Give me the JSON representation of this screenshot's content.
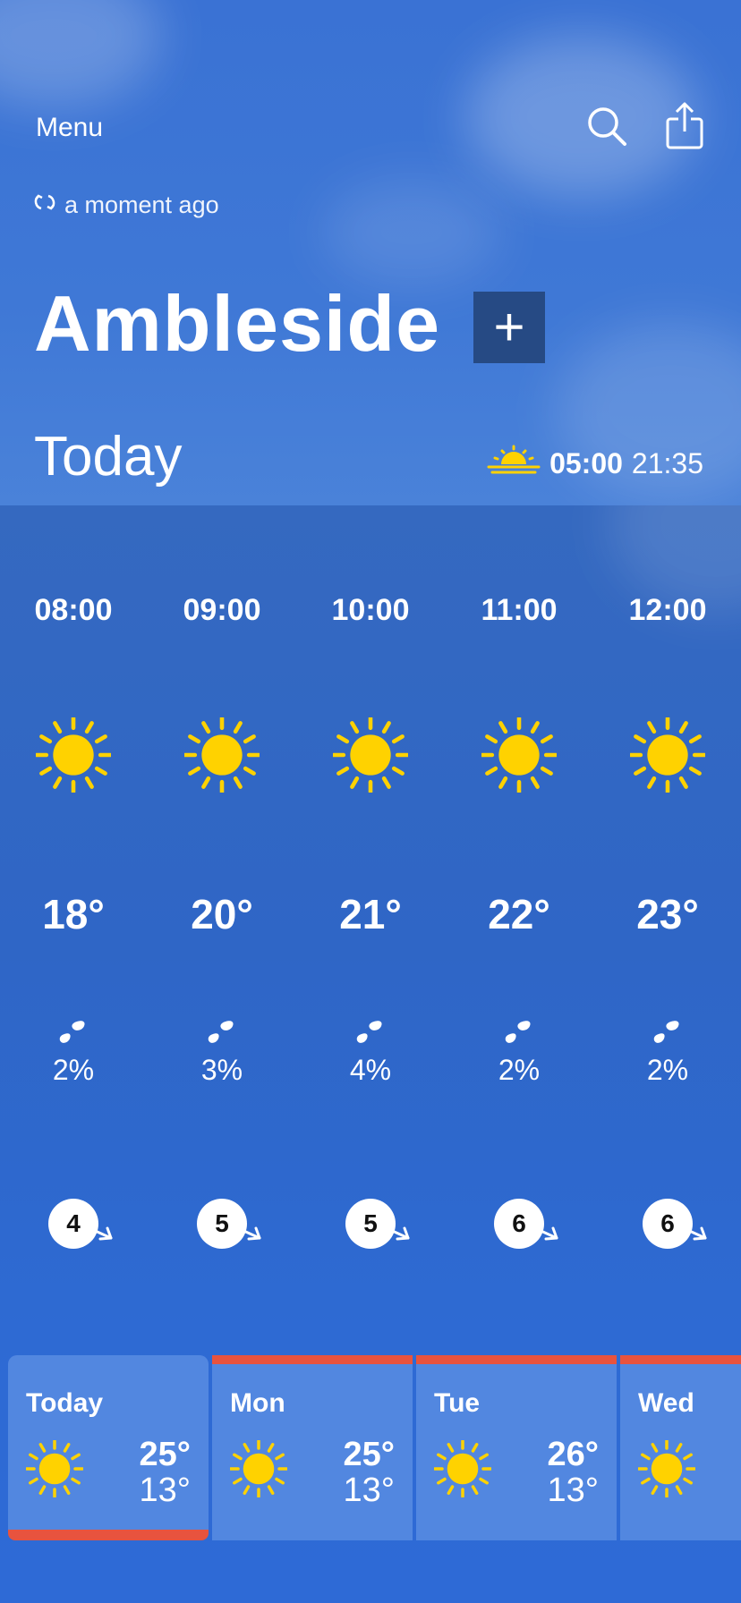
{
  "header": {
    "menu_label": "Menu",
    "updated_text": "a moment ago"
  },
  "location": {
    "name": "Ambleside",
    "add_label": "+"
  },
  "today": {
    "heading": "Today",
    "sunrise": "05:00",
    "sunset": "21:35"
  },
  "hourly": [
    {
      "time": "08:00",
      "icon": "sun-icon",
      "temp": "18°",
      "rain": "2%",
      "wind": "4"
    },
    {
      "time": "09:00",
      "icon": "sun-icon",
      "temp": "20°",
      "rain": "3%",
      "wind": "5"
    },
    {
      "time": "10:00",
      "icon": "sun-icon",
      "temp": "21°",
      "rain": "4%",
      "wind": "5"
    },
    {
      "time": "11:00",
      "icon": "sun-icon",
      "temp": "22°",
      "rain": "2%",
      "wind": "6"
    },
    {
      "time": "12:00",
      "icon": "sun-icon",
      "temp": "23°",
      "rain": "2%",
      "wind": "6"
    }
  ],
  "daily": [
    {
      "day": "Today",
      "icon": "sun-icon",
      "high": "25°",
      "low": "13°",
      "selected": true
    },
    {
      "day": "Mon",
      "icon": "sun-icon",
      "high": "25°",
      "low": "13°"
    },
    {
      "day": "Tue",
      "icon": "sun-icon",
      "high": "26°",
      "low": "13°"
    },
    {
      "day": "Wed",
      "icon": "sun-icon"
    }
  ],
  "colors": {
    "sun": "#FFD200",
    "accent_red": "#E8533E",
    "add_button_bg": "#264A84"
  }
}
